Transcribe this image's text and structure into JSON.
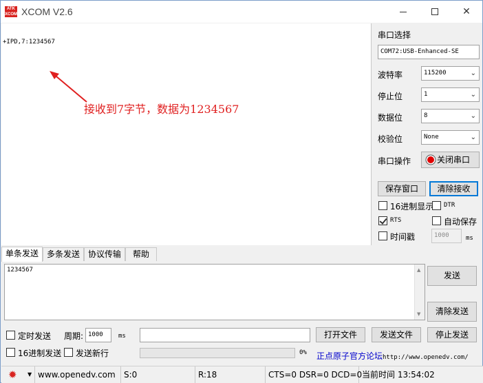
{
  "window": {
    "logo_text": "ATK XCOM",
    "title": "XCOM V2.6",
    "min": "—",
    "max": "☐",
    "close": "✕"
  },
  "receive": {
    "text": "+IPD,7:1234567",
    "annotation": "接收到7字节，数据为1234567",
    "annotation_color": "#e02020"
  },
  "serial": {
    "port_select_label": "串口选择",
    "port": "COM72:USB-Enhanced-SE",
    "baud_label": "波特率",
    "baud": "115200",
    "stop_label": "停止位",
    "stop": "1",
    "data_label": "数据位",
    "data_bits": "8",
    "parity_label": "校验位",
    "parity": "None",
    "op_label": "串口操作",
    "close_port_button": "关闭串口"
  },
  "actions": {
    "save_window": "保存窗口",
    "clear_receive": "清除接收",
    "hex_display": "16进制显示",
    "dtr": "DTR",
    "rts": "RTS",
    "auto_save": "自动保存",
    "timestamp": "时间戳",
    "timestamp_ms": "1000",
    "ms": "ms"
  },
  "tabs": [
    "单条发送",
    "多条发送",
    "协议传输",
    "帮助"
  ],
  "send": {
    "text": "1234567",
    "send_button": "发送",
    "clear_send_button": "清除发送",
    "timed_send": "定时发送",
    "period_label": "周期:",
    "period_value": "1000",
    "period_unit": "ms",
    "open_file": "打开文件",
    "send_file": "发送文件",
    "stop_send": "停止发送",
    "hex_send": "16进制发送",
    "send_newline": "发送新行",
    "progress_percent": "0%",
    "progress_fraction": 0,
    "forum_link": "正点原子官方论坛",
    "forum_url": "http://www.openedv.com/"
  },
  "statusbar": {
    "site": "www.openedv.com",
    "sent": "S:0",
    "received": "R:18",
    "signals": "CTS=0 DSR=0 DCD=0",
    "time": "当前时间 13:54:02"
  },
  "colors": {
    "accent": "#0078d7",
    "logo": "#d8231f"
  }
}
